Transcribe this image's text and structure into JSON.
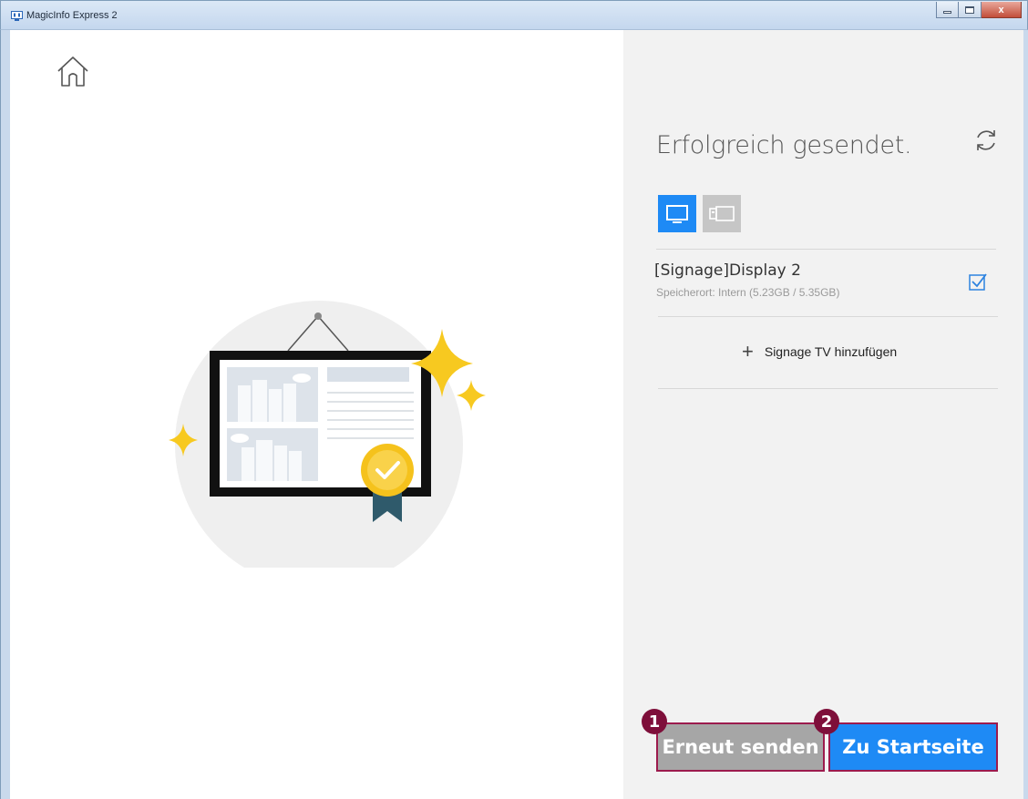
{
  "window": {
    "title": "MagicInfo Express 2",
    "close_label": "x"
  },
  "status": {
    "title": "Erfolgreich gesendet."
  },
  "device_tabs": [
    {
      "name": "display",
      "icon": "monitor-icon",
      "active": true
    },
    {
      "name": "usb",
      "icon": "usb-icon",
      "active": false
    }
  ],
  "device": {
    "name": "[Signage]Display 2",
    "storage": "Speicherort: Intern (5.23GB / 5.35GB)",
    "checked": true
  },
  "add_signage": {
    "plus": "+",
    "label": "Signage TV hinzufügen"
  },
  "buttons": {
    "resend_label": "Erneut senden",
    "home_label": "Zu Startseite",
    "marker_1": "1",
    "marker_2": "2"
  },
  "colors": {
    "accent": "#1e8af5",
    "disabled_button": "#a6a6a6",
    "marker": "#7e0f3a",
    "pane_bg": "#f2f2f2"
  }
}
